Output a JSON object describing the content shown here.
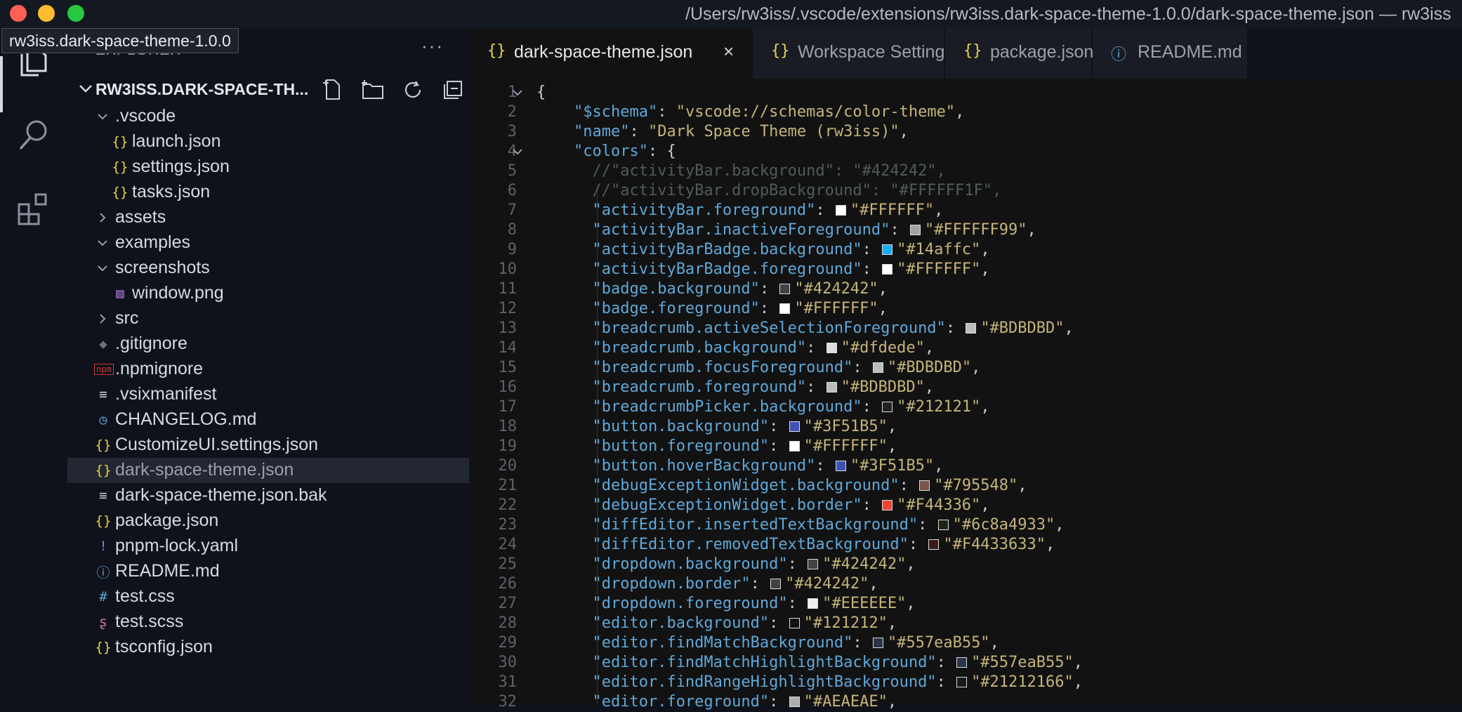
{
  "window": {
    "title": "/Users/rw3iss/.vscode/extensions/rw3iss.dark-space-theme-1.0.0/dark-space-theme.json — rw3iss",
    "tooltip": "rw3iss.dark-space-theme-1.0.0"
  },
  "activity_bar": {
    "items": [
      {
        "name": "files-icon",
        "active": true
      },
      {
        "name": "search-icon",
        "active": false
      },
      {
        "name": "extensions-icon",
        "active": false
      }
    ]
  },
  "sidebar": {
    "header": "EXPLORER",
    "more_label": "···",
    "root_label": "RW3ISS.DARK-SPACE-TH...",
    "tree": [
      {
        "label": ".vscode",
        "type": "folder",
        "open": true,
        "depth": 1,
        "icon": "chevron-down-icon"
      },
      {
        "label": "launch.json",
        "type": "file",
        "depth": 2,
        "icon": "json-icon",
        "glyph": "{}",
        "color": "#e8d44d"
      },
      {
        "label": "settings.json",
        "type": "file",
        "depth": 2,
        "icon": "json-icon",
        "glyph": "{}",
        "color": "#e8d44d"
      },
      {
        "label": "tasks.json",
        "type": "file",
        "depth": 2,
        "icon": "json-icon",
        "glyph": "{}",
        "color": "#e8d44d"
      },
      {
        "label": "assets",
        "type": "folder",
        "open": false,
        "depth": 1
      },
      {
        "label": "examples",
        "type": "folder",
        "open": true,
        "depth": 1
      },
      {
        "label": "screenshots",
        "type": "folder",
        "open": true,
        "depth": 1
      },
      {
        "label": "window.png",
        "type": "file",
        "depth": 2,
        "icon": "image-icon",
        "glyph": "▨",
        "color": "#a874d8"
      },
      {
        "label": "src",
        "type": "folder",
        "open": false,
        "depth": 1
      },
      {
        "label": ".gitignore",
        "type": "file",
        "depth": 1,
        "icon": "git-icon",
        "glyph": "◆",
        "color": "#6b7280"
      },
      {
        "label": ".npmignore",
        "type": "file",
        "depth": 1,
        "icon": "npm-icon",
        "glyph": "npm",
        "color": "#cb3837"
      },
      {
        "label": ".vsixmanifest",
        "type": "file",
        "depth": 1,
        "icon": "text-file-icon",
        "glyph": "≡",
        "color": "#c9ccd2"
      },
      {
        "label": "CHANGELOG.md",
        "type": "file",
        "depth": 1,
        "icon": "clock-icon",
        "glyph": "◷",
        "color": "#5fa8d9"
      },
      {
        "label": "CustomizeUI.settings.json",
        "type": "file",
        "depth": 1,
        "icon": "json-icon",
        "glyph": "{}",
        "color": "#e8d44d"
      },
      {
        "label": "dark-space-theme.json",
        "type": "file",
        "depth": 1,
        "icon": "json-icon",
        "glyph": "{}",
        "color": "#e8d44d",
        "selected": true
      },
      {
        "label": "dark-space-theme.json.bak",
        "type": "file",
        "depth": 1,
        "icon": "text-file-icon",
        "glyph": "≡",
        "color": "#c9ccd2"
      },
      {
        "label": "package.json",
        "type": "file",
        "depth": 1,
        "icon": "json-icon",
        "glyph": "{}",
        "color": "#e8d44d"
      },
      {
        "label": "pnpm-lock.yaml",
        "type": "file",
        "depth": 1,
        "icon": "yaml-icon",
        "glyph": "!",
        "color": "#a874d8"
      },
      {
        "label": "README.md",
        "type": "file",
        "depth": 1,
        "icon": "info-icon",
        "glyph": "ⓘ",
        "color": "#5fa8d9"
      },
      {
        "label": "test.css",
        "type": "file",
        "depth": 1,
        "icon": "css-icon",
        "glyph": "#",
        "color": "#5fa8d9"
      },
      {
        "label": "test.scss",
        "type": "file",
        "depth": 1,
        "icon": "scss-icon",
        "glyph": "ʂ",
        "color": "#e07a9a"
      },
      {
        "label": "tsconfig.json",
        "type": "file",
        "depth": 1,
        "icon": "json-icon",
        "glyph": "{}",
        "color": "#e8d44d"
      }
    ]
  },
  "tabs": [
    {
      "label": "dark-space-theme.json",
      "icon": "json-icon",
      "glyph": "{}",
      "active": true,
      "close": "×"
    },
    {
      "label": "Workspace Settings",
      "icon": "json-icon",
      "glyph": "{}",
      "active": false
    },
    {
      "label": "package.json",
      "icon": "json-icon",
      "glyph": "{}",
      "active": false
    },
    {
      "label": "README.md",
      "icon": "info-icon",
      "glyph": "ⓘ",
      "active": false
    }
  ],
  "code": {
    "lines": [
      {
        "n": "1",
        "fold": true,
        "parts": [
          [
            "p",
            "{"
          ]
        ]
      },
      {
        "n": "2",
        "parts": [
          [
            "p",
            "    "
          ],
          [
            "k",
            "\"$schema\""
          ],
          [
            "p",
            ": "
          ],
          [
            "s",
            "\"vscode://schemas/color-theme\""
          ],
          [
            "p",
            ","
          ]
        ]
      },
      {
        "n": "3",
        "parts": [
          [
            "p",
            "    "
          ],
          [
            "k",
            "\"name\""
          ],
          [
            "p",
            ": "
          ],
          [
            "s",
            "\"Dark Space Theme (rw3iss)\""
          ],
          [
            "p",
            ","
          ]
        ]
      },
      {
        "n": "4",
        "fold": true,
        "parts": [
          [
            "p",
            "    "
          ],
          [
            "k",
            "\"colors\""
          ],
          [
            "p",
            ": {"
          ]
        ]
      },
      {
        "n": "5",
        "parts": [
          [
            "p",
            "      "
          ],
          [
            "c",
            "//\"activityBar.background\": \"#424242\","
          ]
        ]
      },
      {
        "n": "6",
        "parts": [
          [
            "p",
            "      "
          ],
          [
            "c",
            "//\"activityBar.dropBackground\": \"#FFFFFF1F\","
          ]
        ]
      },
      {
        "n": "7",
        "key": "activityBar.foreground",
        "val": "#FFFFFF",
        "sw": "#FFFFFF"
      },
      {
        "n": "8",
        "key": "activityBar.inactiveForeground",
        "val": "#FFFFFF99",
        "sw": "#a3a3a3"
      },
      {
        "n": "9",
        "key": "activityBarBadge.background",
        "val": "#14affc",
        "sw": "#14affc"
      },
      {
        "n": "10",
        "key": "activityBarBadge.foreground",
        "val": "#FFFFFF",
        "sw": "#FFFFFF"
      },
      {
        "n": "11",
        "key": "badge.background",
        "val": "#424242",
        "sw": "#424242"
      },
      {
        "n": "12",
        "key": "badge.foreground",
        "val": "#FFFFFF",
        "sw": "#FFFFFF"
      },
      {
        "n": "13",
        "key": "breadcrumb.activeSelectionForeground",
        "val": "#BDBDBD",
        "sw": "#BDBDBD"
      },
      {
        "n": "14",
        "key": "breadcrumb.background",
        "val": "#dfdede",
        "sw": "#dfdede"
      },
      {
        "n": "15",
        "key": "breadcrumb.focusForeground",
        "val": "#BDBDBD",
        "sw": "#BDBDBD"
      },
      {
        "n": "16",
        "key": "breadcrumb.foreground",
        "val": "#BDBDBD",
        "sw": "#BDBDBD"
      },
      {
        "n": "17",
        "key": "breadcrumbPicker.background",
        "val": "#212121",
        "sw": "#212121"
      },
      {
        "n": "18",
        "key": "button.background",
        "val": "#3F51B5",
        "sw": "#3F51B5"
      },
      {
        "n": "19",
        "key": "button.foreground",
        "val": "#FFFFFF",
        "sw": "#FFFFFF"
      },
      {
        "n": "20",
        "key": "button.hoverBackground",
        "val": "#3F51B5",
        "sw": "#3F51B5"
      },
      {
        "n": "21",
        "key": "debugExceptionWidget.background",
        "val": "#795548",
        "sw": "#795548"
      },
      {
        "n": "22",
        "key": "debugExceptionWidget.border",
        "val": "#F44336",
        "sw": "#F44336"
      },
      {
        "n": "23",
        "key": "diffEditor.insertedTextBackground",
        "val": "#6c8a4933",
        "sw": "#1f2416"
      },
      {
        "n": "24",
        "key": "diffEditor.removedTextBackground",
        "val": "#F4433633",
        "sw": "#3b1b19"
      },
      {
        "n": "25",
        "key": "dropdown.background",
        "val": "#424242",
        "sw": "#424242"
      },
      {
        "n": "26",
        "key": "dropdown.border",
        "val": "#424242",
        "sw": "#424242"
      },
      {
        "n": "27",
        "key": "dropdown.foreground",
        "val": "#EEEEEE",
        "sw": "#EEEEEE"
      },
      {
        "n": "28",
        "key": "editor.background",
        "val": "#121212",
        "sw": "#121212"
      },
      {
        "n": "29",
        "key": "editor.findMatchBackground",
        "val": "#557eaB55",
        "sw": "#2a3547"
      },
      {
        "n": "30",
        "key": "editor.findMatchHighlightBackground",
        "val": "#557eaB55",
        "sw": "#2a3547"
      },
      {
        "n": "31",
        "key": "editor.findRangeHighlightBackground",
        "val": "#21212166",
        "sw": "#191919"
      },
      {
        "n": "32",
        "key": "editor.foreground",
        "val": "#AEAEAE",
        "sw": "#AEAEAE"
      }
    ]
  }
}
